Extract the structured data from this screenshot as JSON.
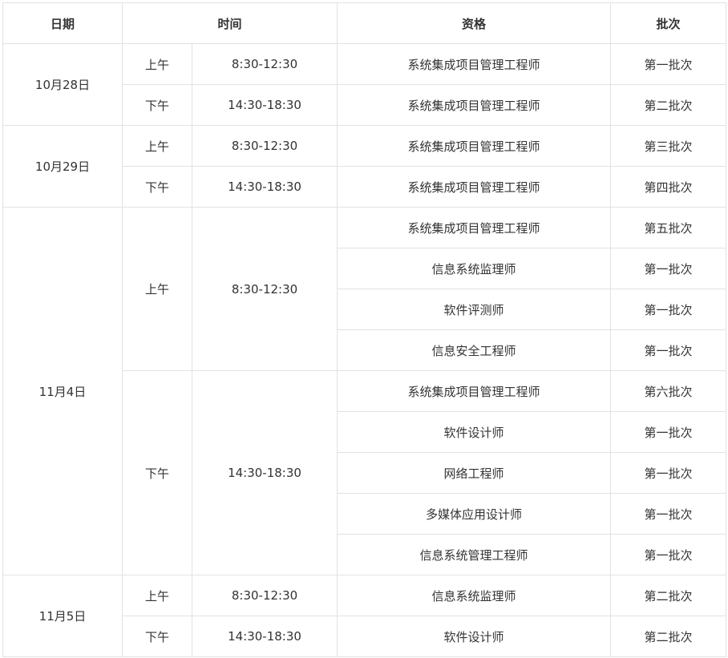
{
  "headers": {
    "date": "日期",
    "time": "时间",
    "qualification": "资格",
    "batch": "批次"
  },
  "groups": [
    {
      "date": "10月28日",
      "sessions": [
        {
          "period": "上午",
          "time": "8:30-12:30",
          "rows": [
            {
              "qualification": "系统集成项目管理工程师",
              "batch": "第一批次"
            }
          ]
        },
        {
          "period": "下午",
          "time": "14:30-18:30",
          "rows": [
            {
              "qualification": "系统集成项目管理工程师",
              "batch": "第二批次"
            }
          ]
        }
      ]
    },
    {
      "date": "10月29日",
      "sessions": [
        {
          "period": "上午",
          "time": "8:30-12:30",
          "rows": [
            {
              "qualification": "系统集成项目管理工程师",
              "batch": "第三批次"
            }
          ]
        },
        {
          "period": "下午",
          "time": "14:30-18:30",
          "rows": [
            {
              "qualification": "系统集成项目管理工程师",
              "batch": "第四批次"
            }
          ]
        }
      ]
    },
    {
      "date": "11月4日",
      "sessions": [
        {
          "period": "上午",
          "time": "8:30-12:30",
          "rows": [
            {
              "qualification": "系统集成项目管理工程师",
              "batch": "第五批次"
            },
            {
              "qualification": "信息系统监理师",
              "batch": "第一批次"
            },
            {
              "qualification": "软件评测师",
              "batch": "第一批次"
            },
            {
              "qualification": "信息安全工程师",
              "batch": "第一批次"
            }
          ]
        },
        {
          "period": "下午",
          "time": "14:30-18:30",
          "rows": [
            {
              "qualification": "系统集成项目管理工程师",
              "batch": "第六批次"
            },
            {
              "qualification": "软件设计师",
              "batch": "第一批次"
            },
            {
              "qualification": "网络工程师",
              "batch": "第一批次"
            },
            {
              "qualification": "多媒体应用设计师",
              "batch": "第一批次"
            },
            {
              "qualification": "信息系统管理工程师",
              "batch": "第一批次"
            }
          ]
        }
      ]
    },
    {
      "date": "11月5日",
      "sessions": [
        {
          "period": "上午",
          "time": "8:30-12:30",
          "rows": [
            {
              "qualification": "信息系统监理师",
              "batch": "第二批次"
            }
          ]
        },
        {
          "period": "下午",
          "time": "14:30-18:30",
          "rows": [
            {
              "qualification": "软件设计师",
              "batch": "第二批次"
            }
          ]
        }
      ]
    }
  ]
}
